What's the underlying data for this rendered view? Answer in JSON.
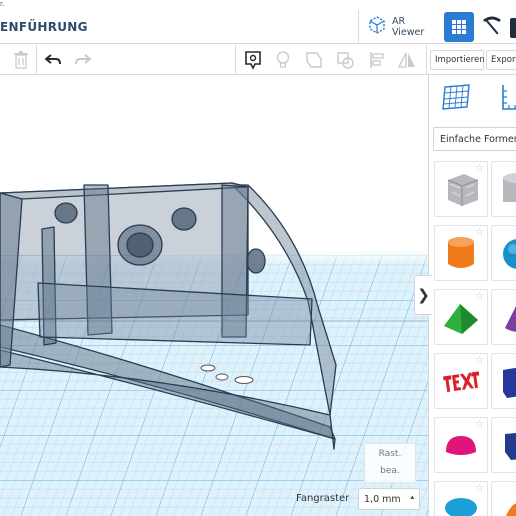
{
  "window": {
    "title_fragment": "r.",
    "project_title": "ENFÜHRUNG"
  },
  "topbar": {
    "ar_viewer_label": "AR Viewer",
    "icons": [
      "ar-cube-icon",
      "grid-view-icon",
      "pickaxe-icon",
      "cut-icon"
    ]
  },
  "toolbar": {
    "icons": [
      "delete-icon",
      "undo-icon",
      "redo-icon",
      "notes-icon",
      "bulb-icon",
      "shape-outline-icon",
      "group-icon",
      "align-icon",
      "mirror-icon"
    ],
    "import_label": "Importieren",
    "export_label": "Exportie"
  },
  "viewport": {
    "snap_label": "Fangraster",
    "snap_value": "1,0 mm",
    "edit_grid_line1": "Rast.",
    "edit_grid_line2": "bea.",
    "panel_toggle": "❯"
  },
  "right_panel": {
    "icons": [
      "workplane-icon",
      "ruler-icon"
    ],
    "shapes_dropdown": "Einfache Formen",
    "shapes": [
      {
        "name": "box-hole",
        "color": "#b7b7bd"
      },
      {
        "name": "cylinder-hole",
        "color": "#b7b7bd"
      },
      {
        "name": "cylinder",
        "color": "#ef7c1a"
      },
      {
        "name": "sphere",
        "color": "#1890c9"
      },
      {
        "name": "roof",
        "color": "#2fb03c"
      },
      {
        "name": "cone",
        "color": "#7b3fa0"
      },
      {
        "name": "text",
        "color": "#d8232a"
      },
      {
        "name": "box",
        "color": "#26399a"
      },
      {
        "name": "half-sphere",
        "color": "#e0157a"
      },
      {
        "name": "polygon",
        "color": "#1f3d8c"
      },
      {
        "name": "torus",
        "color": "#1a9fd6"
      },
      {
        "name": "paraboloid",
        "color": "#ef7c1a"
      }
    ]
  }
}
